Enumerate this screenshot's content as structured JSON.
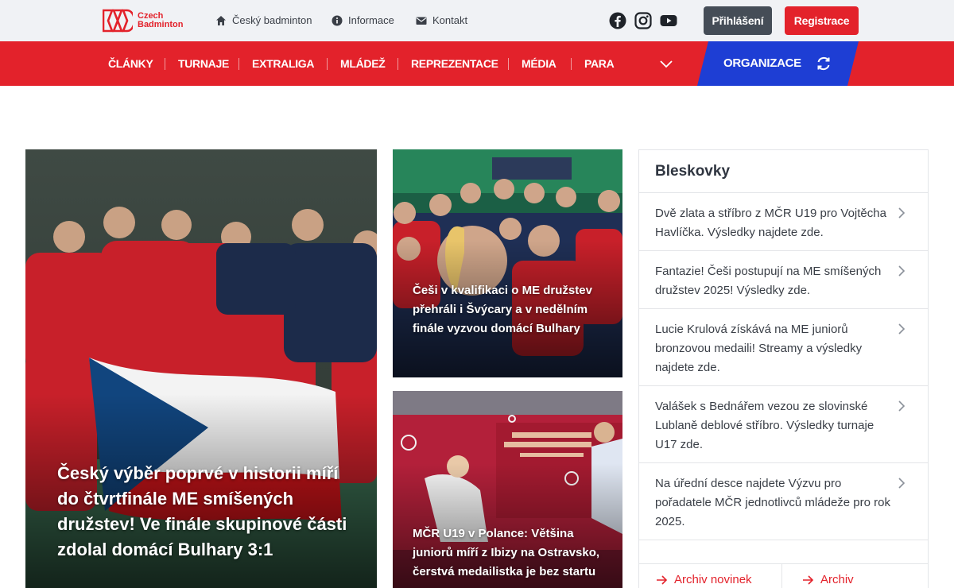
{
  "logo": {
    "line1": "Czech",
    "line2": "Badminton",
    "mark": "BAD"
  },
  "topnav": [
    {
      "label": "Český badminton",
      "icon": "home-icon"
    },
    {
      "label": "Informace",
      "icon": "info-icon"
    },
    {
      "label": "Kontakt",
      "icon": "mail-icon"
    }
  ],
  "social": [
    "facebook-icon",
    "instagram-icon",
    "youtube-icon"
  ],
  "auth": {
    "login": "Přihlášení",
    "register": "Registrace"
  },
  "mainnav": [
    "ČLÁNKY",
    "TURNAJE",
    "EXTRALIGA",
    "MLÁDEŽ",
    "REPREZENTACE",
    "MÉDIA",
    "PARA"
  ],
  "org": {
    "label": "ORGANIZACE"
  },
  "featured": {
    "big": {
      "title": "Český výběr poprvé v historii míří do čtvrtfinále ME smíšených družstev! Ve finále skupinové části zdolal domácí Bulhary 3:1"
    },
    "small1": {
      "title": "Češi v kvalifikaci o ME družstev přehráli i Švýcary a v nedělním finále vyzvou domácí Bulhary"
    },
    "small2": {
      "title": "MČR U19 v Polance: Většina juniorů míří z Ibizy na Ostravsko, čerstvá medailistka je bez startu"
    }
  },
  "news": {
    "heading": "Bleskovky",
    "items": [
      "Dvě zlata a stříbro z MČR U19 pro Vojtěcha Havlíčka. Výsledky najdete zde.",
      "Fantazie! Češi postupují na ME smíšených družstev 2025! Výsledky zde.",
      "Lucie Krulová získává na ME juniorů bronzovou medaili! Streamy a výsledky najdete zde.",
      "Valášek s Bednářem vezou ze slovinské Lublaně deblové stříbro. Výsledky turnaje U17 zde.",
      "Na úřední desce najdete Výzvu pro pořadatele MČR jednotlivců mládeže pro rok 2025."
    ],
    "archive1": "Archiv novinek",
    "archive2": "Archiv"
  },
  "colors": {
    "brand_red": "#e3222b",
    "org_blue": "#1e3ed4",
    "login_gray": "#454d57"
  }
}
